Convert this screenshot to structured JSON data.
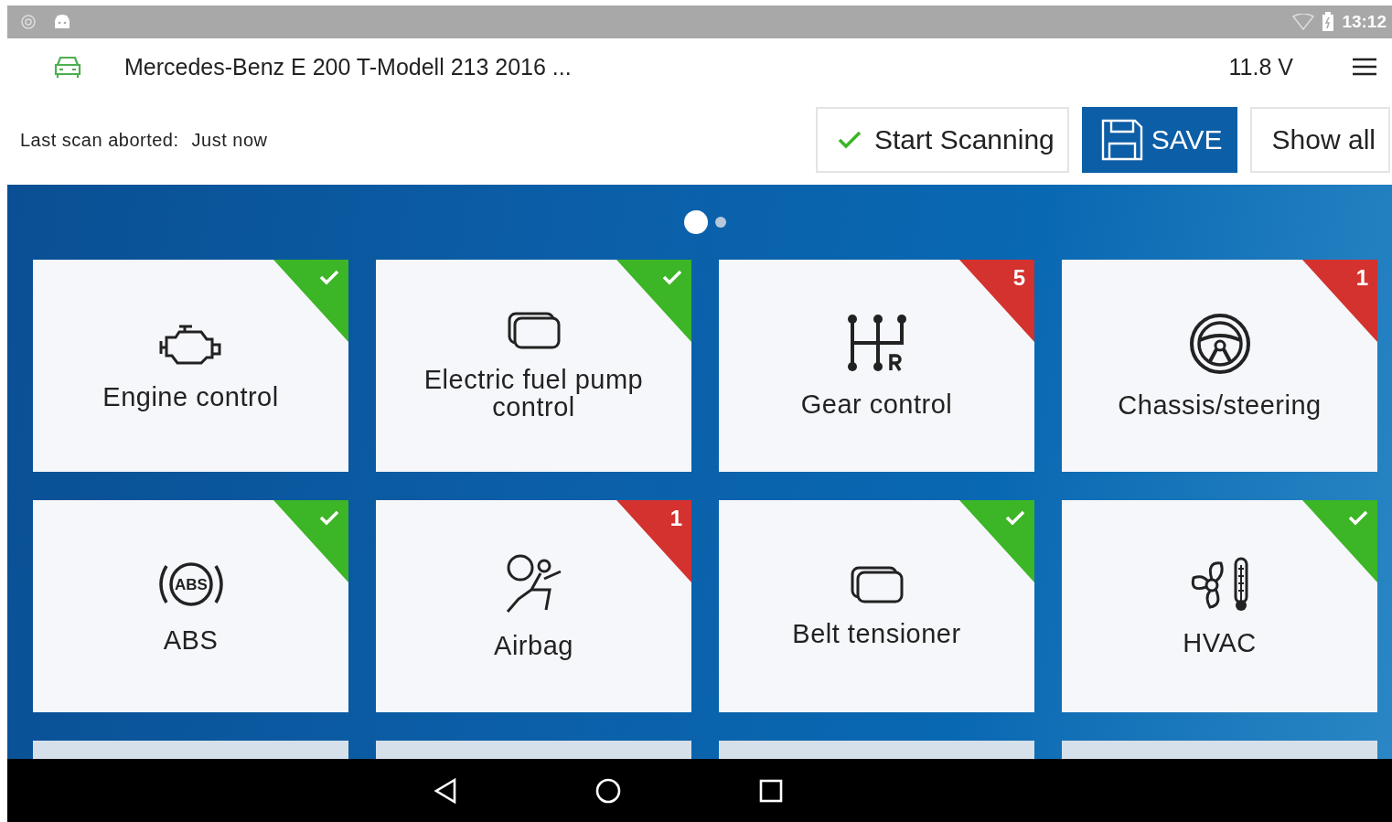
{
  "status_bar": {
    "time": "13:12"
  },
  "header": {
    "vehicle": "Mercedes-Benz E 200 T-Modell 213 2016 ...",
    "voltage": "11.8 V"
  },
  "scan": {
    "label": "Last scan aborted:",
    "value": "Just now"
  },
  "buttons": [
    {
      "kind": "scan",
      "label": "Start Scanning"
    },
    {
      "kind": "save",
      "label": "SAVE"
    },
    {
      "kind": "plain",
      "label": "Show all"
    }
  ],
  "pager": [
    {
      "selected": true
    },
    {
      "selected": false
    }
  ],
  "tiles": [
    {
      "label": "Engine control",
      "kind": "ok"
    },
    {
      "label": "Electric fuel pump control",
      "kind": "ok"
    },
    {
      "label": "Gear control",
      "kind": "error",
      "count": "5"
    },
    {
      "label": "Chassis/steering",
      "kind": "error",
      "count": "1"
    },
    {
      "label": "ABS",
      "kind": "ok",
      "icon_text": "ABS"
    },
    {
      "label": "Airbag",
      "kind": "error",
      "count": "1"
    },
    {
      "label": "Belt tensioner",
      "kind": "ok"
    },
    {
      "label": "HVAC",
      "kind": "ok"
    }
  ]
}
